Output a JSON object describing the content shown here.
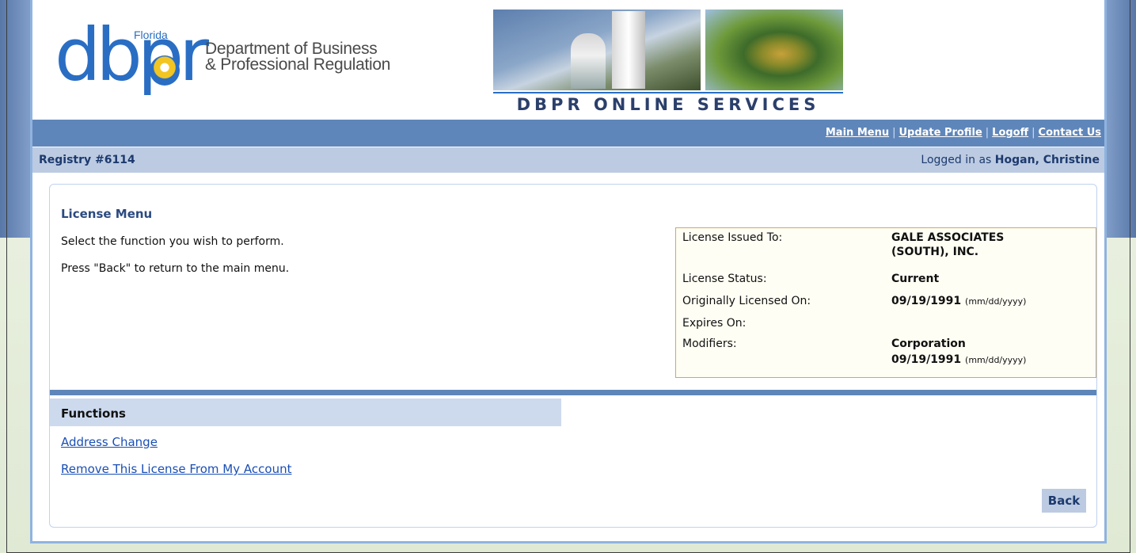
{
  "header": {
    "logo_state": "Florida",
    "logo_text": "dbpr",
    "logo_dept_line1": "Department of Business",
    "logo_dept_line2": "& Professional Regulation",
    "banner_title": "DBPR ONLINE SERVICES"
  },
  "nav": {
    "items": [
      {
        "label": "Main Menu"
      },
      {
        "label": "Update Profile"
      },
      {
        "label": "Logoff"
      },
      {
        "label": "Contact Us"
      }
    ],
    "separator": "|"
  },
  "infobar": {
    "registry": "Registry #6114",
    "logged_in_prefix": "Logged in as ",
    "user": "Hogan, Christine"
  },
  "license_menu": {
    "title": "License Menu",
    "instruction1": "Select the function you wish to perform.",
    "instruction2": "Press \"Back\" to return to the main menu."
  },
  "details": {
    "issued_to_label": "License Issued To:",
    "issued_to_line1": "GALE ASSOCIATES",
    "issued_to_line2": "(SOUTH), INC.",
    "status_label": "License Status:",
    "status_value": "Current",
    "orig_label": "Originally Licensed On:",
    "orig_value": "09/19/1991",
    "date_format": "(mm/dd/yyyy)",
    "expires_label": "Expires On:",
    "modifiers_label": "Modifiers:",
    "modifier_value": "Corporation",
    "modifier_date": "09/19/1991"
  },
  "functions": {
    "title": "Functions",
    "links": [
      {
        "label": "Address Change"
      },
      {
        "label": "Remove This License From My Account"
      }
    ]
  },
  "back_label": "Back"
}
